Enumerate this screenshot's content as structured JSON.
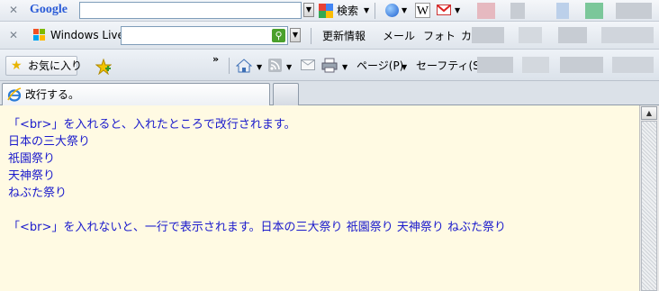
{
  "google_bar": {
    "logo": "Google",
    "search_button": "検索"
  },
  "live_bar": {
    "logo": "Windows Live",
    "links": [
      "更新情報",
      "メール",
      "フォト",
      "カ"
    ]
  },
  "command_bar": {
    "favorites": "お気に入り",
    "page_menu": "ページ(P)",
    "safety_menu": "セーフティ(S)"
  },
  "tab": {
    "title": "改行する。"
  },
  "content": {
    "lines": [
      "「<br>」を入れると、入れたところで改行されます。",
      "日本の三大祭り",
      "祇園祭り",
      "天神祭り",
      "ねぶた祭り",
      "「<br>」を入れないと、一行で表示されます。日本の三大祭り 祇園祭り 天神祭り ねぶた祭り"
    ],
    "text_color": "#1a1acc",
    "background": "#fffae3"
  }
}
